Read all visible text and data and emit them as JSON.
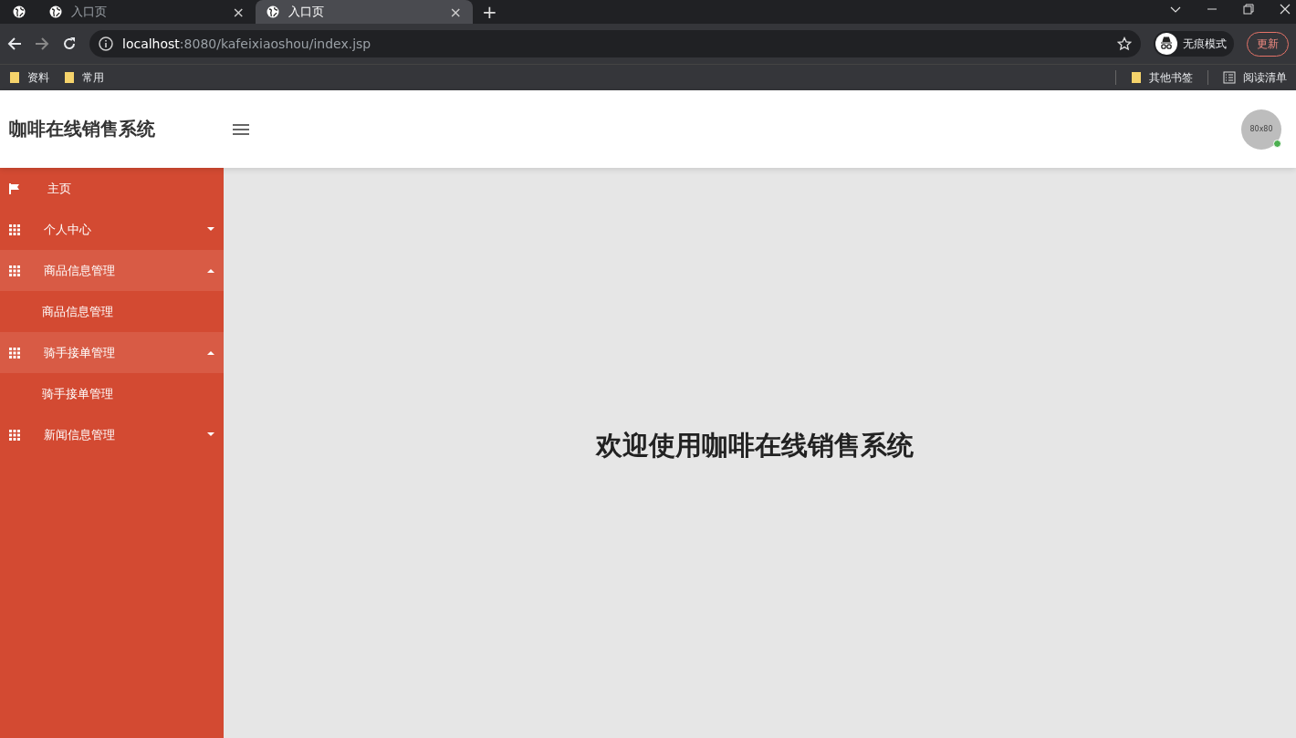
{
  "browser": {
    "tabs": [
      {
        "kind": "pinned",
        "selected": false
      },
      {
        "kind": "normal",
        "label": "入口页",
        "close": "×",
        "selected": false
      },
      {
        "kind": "normal",
        "label": "入口页",
        "close": "×",
        "selected": true
      }
    ],
    "new_tab": "+",
    "url_host": "localhost",
    "url_rest": ":8080/kafeixiaoshou/index.jsp",
    "incognito": "无痕模式",
    "update": "更新",
    "bookmarks_left": [
      "资料",
      "常用"
    ],
    "other_bookmarks": "其他书签",
    "reading_list": "阅读清单"
  },
  "header": {
    "title": "咖啡在线销售系统",
    "avatar": "80x80",
    "online": true
  },
  "sidebar": {
    "items": [
      {
        "kind": "link",
        "label": "主页"
      },
      {
        "kind": "group",
        "label": "个人中心",
        "expanded": false
      },
      {
        "kind": "group",
        "label": "商品信息管理",
        "expanded": true,
        "children": [
          {
            "label": "商品信息管理"
          }
        ]
      },
      {
        "kind": "group",
        "label": "骑手接单管理",
        "expanded": true,
        "children": [
          {
            "label": "骑手接单管理"
          }
        ]
      },
      {
        "kind": "group",
        "label": "新闻信息管理",
        "expanded": false
      }
    ]
  },
  "main": {
    "welcome": "欢迎使用咖啡在线销售系统"
  }
}
